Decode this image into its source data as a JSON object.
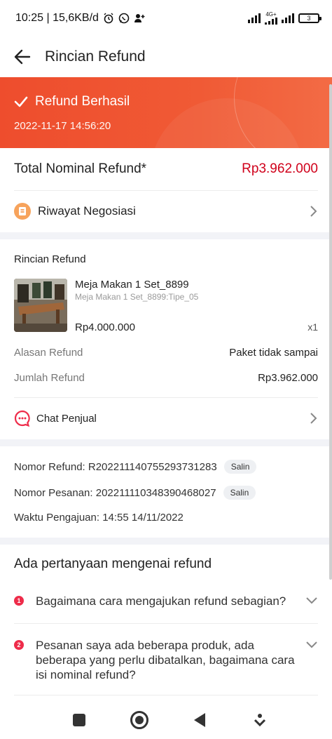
{
  "status_bar": {
    "left_text": "10:25 | 15,6KB/d",
    "network": "4G+",
    "battery": "3"
  },
  "header": {
    "title": "Rincian Refund"
  },
  "banner": {
    "status": "Refund Berhasil",
    "datetime": "2022-11-17 14:56:20",
    "color": "#ee4d2d"
  },
  "total": {
    "label": "Total Nominal Refund*",
    "value": "Rp3.962.000",
    "value_color": "#d0011b"
  },
  "negotiation": {
    "label": "Riwayat Negosiasi",
    "icon": "history-icon"
  },
  "details": {
    "section_title": "Rincian Refund",
    "product": {
      "name": "Meja Makan 1 Set_8899",
      "variant": "Meja Makan 1 Set_8899:Tipe_05",
      "price": "Rp4.000.000",
      "qty": "x1"
    },
    "reason_label": "Alasan Refund",
    "reason_value": "Paket tidak sampai",
    "amount_label": "Jumlah Refund",
    "amount_value": "Rp3.962.000"
  },
  "chat": {
    "label": "Chat Penjual",
    "icon": "chat-icon"
  },
  "info": {
    "refund_no": "Nomor Refund: R2022111407552937312 83",
    "refund_no_text": "Nomor Refund: R20221114075529373128 3",
    "refund_number_line": "Nomor Refund: R202211140755293731283",
    "order_number_line": "Nomor Pesanan: 2022111103483904680 27",
    "order_line": "Nomor Pesanan: 22111103483904680 27",
    "order_number": "Nomor Pesanan: 20221111034839046802 7",
    "order_text": "Nomor Pesanan: 2022111103483904680 27",
    "copy_label": "Salin",
    "submitted_line": "Waktu Pengajuan: 14:55 14/11/2022"
  },
  "faq": {
    "title": "Ada pertanyaan mengenai refund",
    "items": [
      {
        "num": "1",
        "question": "Bagaimana cara mengajukan refund sebagian?"
      },
      {
        "num": "2",
        "question": "Pesanan saya ada beberapa produk, ada beberapa yang perlu dibatalkan, bagaimana cara isi nominal refund?"
      }
    ]
  }
}
